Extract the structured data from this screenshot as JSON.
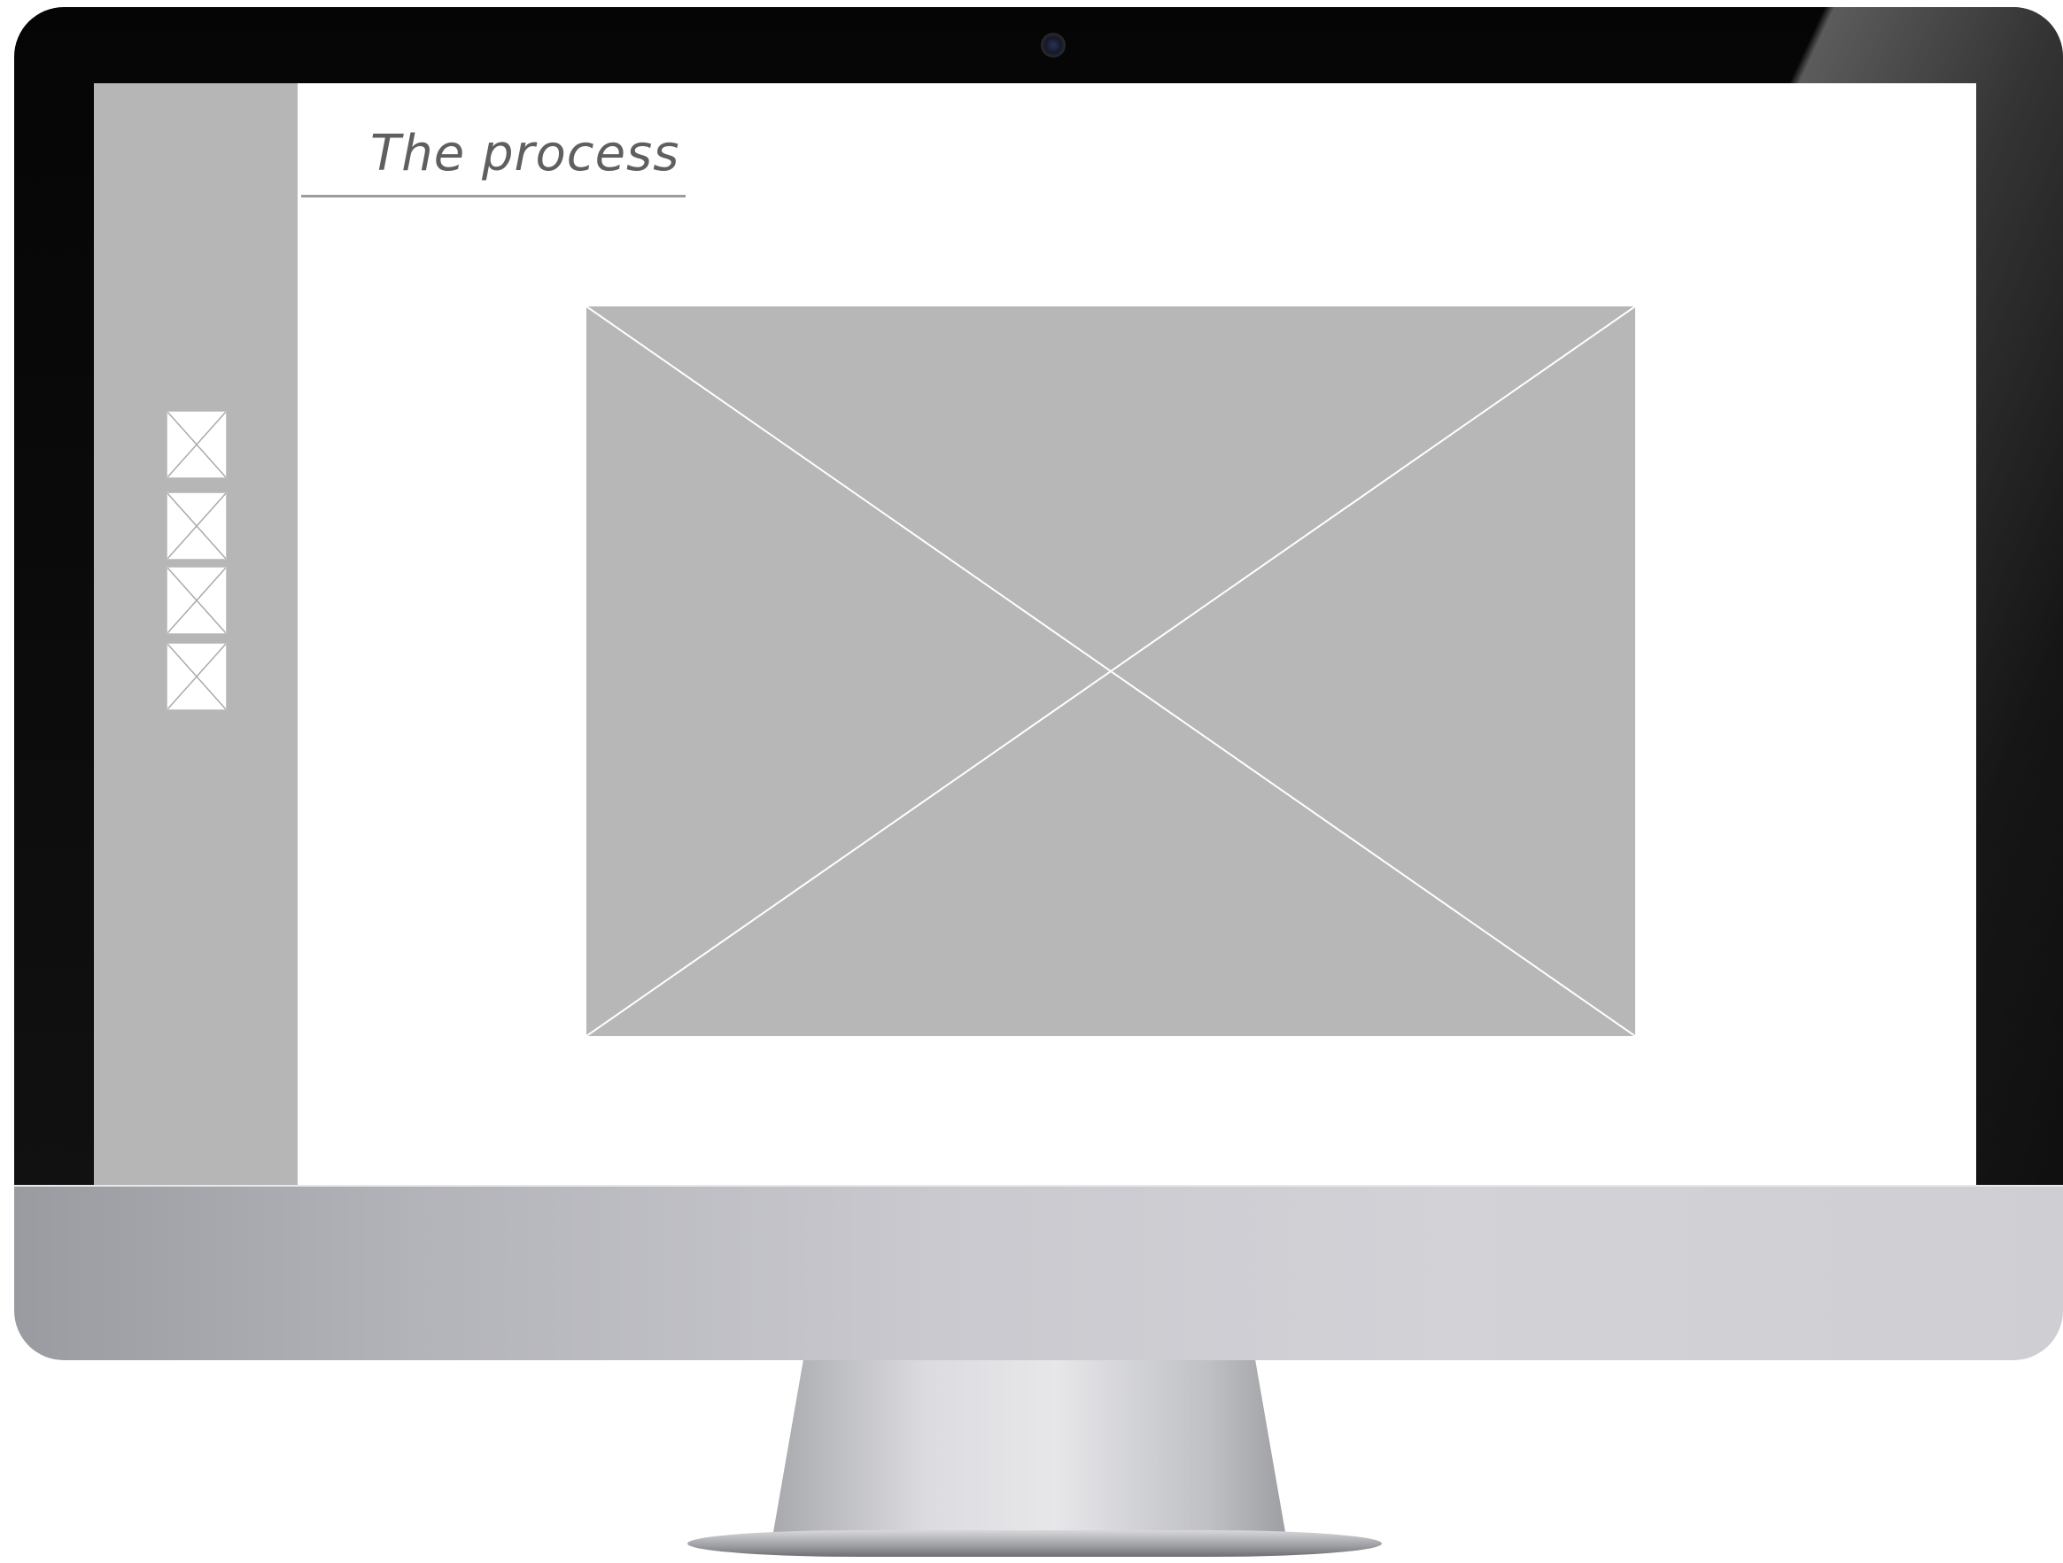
{
  "page": {
    "title": "The process"
  },
  "sidebar": {
    "thumbnails": [
      {
        "icon": "image-placeholder-icon"
      },
      {
        "icon": "image-placeholder-icon"
      },
      {
        "icon": "image-placeholder-icon"
      },
      {
        "icon": "image-placeholder-icon"
      }
    ]
  },
  "main": {
    "hero_image": {
      "icon": "image-placeholder-icon"
    }
  },
  "colors": {
    "sidebar": "#b6b6b6",
    "placeholder": "#b7b7b7",
    "title_text": "#5f5f5f",
    "bezel": "#050505",
    "chin": "#c9c9cf"
  }
}
